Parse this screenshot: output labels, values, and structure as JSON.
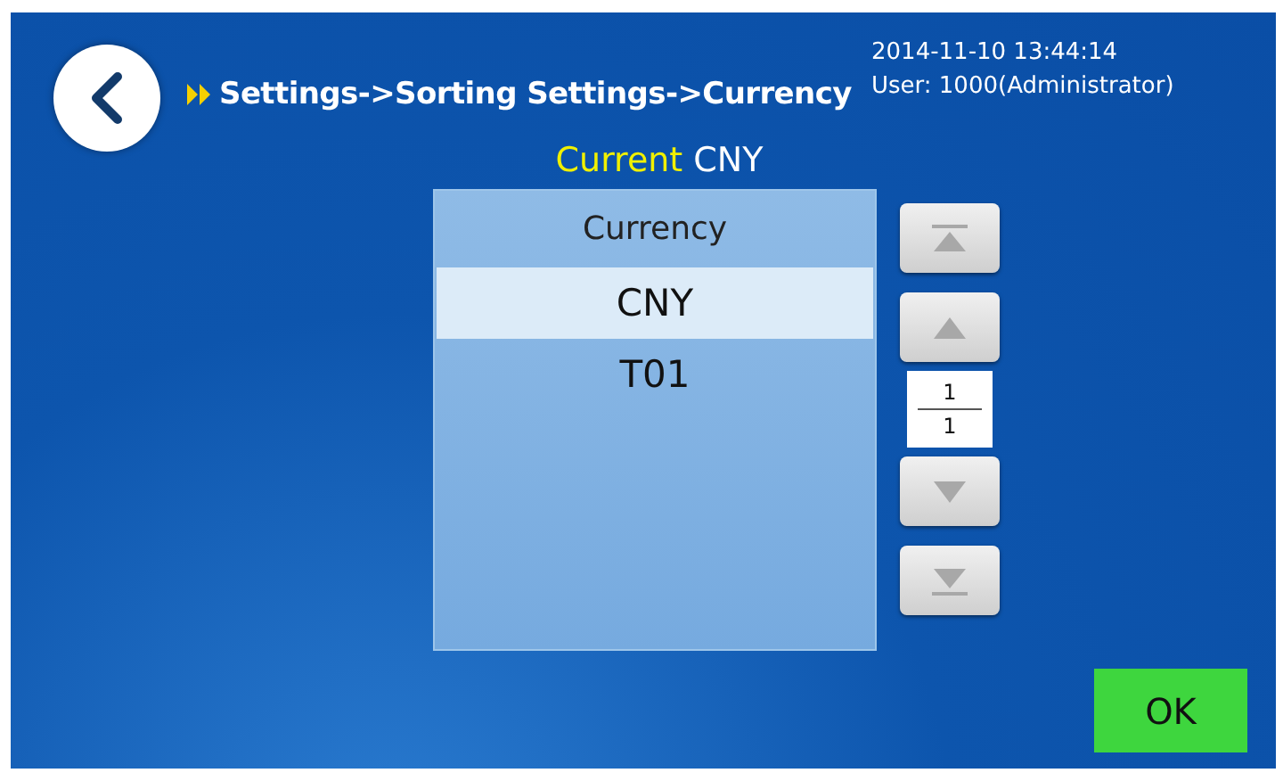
{
  "breadcrumb": "Settings->Sorting Settings->Currency",
  "datetime": "2014-11-10  13:44:14",
  "user": "User: 1000(Administrator)",
  "current": {
    "label": "Current",
    "value": "CNY"
  },
  "list": {
    "header": "Currency",
    "items": [
      {
        "label": "CNY",
        "selected": true
      },
      {
        "label": "T01",
        "selected": false
      }
    ]
  },
  "nav_buttons": [
    {
      "kind": "first",
      "disabled": true
    },
    {
      "kind": "up",
      "disabled": true
    },
    {
      "kind": "down",
      "disabled": true
    },
    {
      "kind": "last",
      "disabled": true
    }
  ],
  "pager": {
    "page": "1",
    "total": "1"
  },
  "ok_button": "OK"
}
